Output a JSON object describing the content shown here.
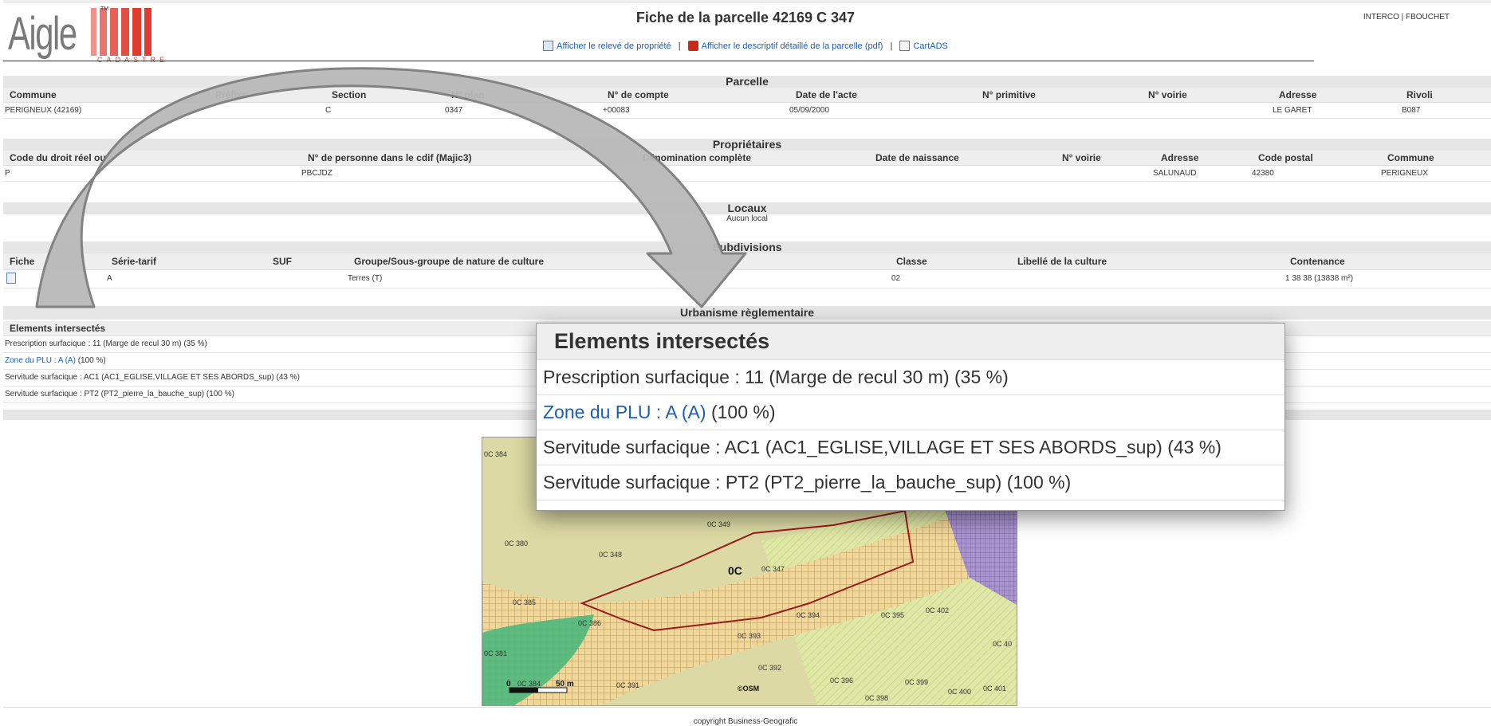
{
  "header": {
    "logo_word": "Aigle",
    "logo_sub": "CADASTRE",
    "logo_tm": "TM",
    "title": "Fiche de la parcelle 42169 C 347",
    "user": "INTERCO | FBOUCHET",
    "links": {
      "releve": "Afficher le relevé de propriété",
      "descriptif": "Afficher le descriptif détaillé de la parcelle (pdf)",
      "cartads": "CartADS",
      "sep": "|"
    }
  },
  "parcelle": {
    "title": "Parcelle",
    "headers": [
      "Commune",
      "Préfixe",
      "Section",
      "N° plan",
      "N° de compte",
      "Date de l'acte",
      "N° primitive",
      "N° voirie",
      "Adresse",
      "Rivoli"
    ],
    "row": [
      "PERIGNEUX (42169)",
      "",
      "C",
      "0347",
      "+00083",
      "05/09/2000",
      "",
      "",
      "LE GARET",
      "B087"
    ]
  },
  "proprietaires": {
    "title": "Propriétaires",
    "headers": [
      "Code du droit réel ou",
      "N° de personne dans le cdif (Majic3)",
      "Dénomination complète",
      "Date de naissance",
      "N° voirie",
      "Adresse",
      "Code postal",
      "Commune"
    ],
    "row": [
      "P",
      "PBCJDZ",
      "",
      "",
      "",
      "SALUNAUD",
      "42380",
      "PERIGNEUX"
    ]
  },
  "locaux": {
    "title": "Locaux",
    "empty": "Aucun local"
  },
  "subdivisions": {
    "title": "Subdivisions",
    "headers": [
      "Fiche",
      "Série-tarif",
      "SUF",
      "Groupe/Sous-groupe de nature de culture",
      "Classe",
      "Libellé de la culture",
      "Contenance"
    ],
    "row": [
      "",
      "A",
      "",
      "Terres (T)",
      "02",
      "",
      "1 38 38 (13838 m²)"
    ]
  },
  "urbanisme": {
    "title": "Urbanisme règlementaire",
    "header": "Elements intersectés",
    "items": [
      {
        "link": "",
        "text": "Prescription surfacique : 11 (Marge de recul 30 m) (35 %)"
      },
      {
        "link": "Zone du PLU : A (A)",
        "text": " (100 %)"
      },
      {
        "link": "",
        "text": "Servitude surfacique : AC1 (AC1_EGLISE,VILLAGE ET SES ABORDS_sup) (43 %)"
      },
      {
        "link": "",
        "text": "Servitude surfacique : PT2 (PT2_pierre_la_bauche_sup) (100 %)"
      }
    ]
  },
  "map": {
    "labels": [
      "0C 384",
      "0C 349",
      "0C 380",
      "0C 348",
      "0C 347",
      "0C 385",
      "0C 386",
      "0C 394",
      "0C 395",
      "0C 402",
      "0C 381",
      "0C 393",
      "0C 392",
      "0C 384",
      "0C 391",
      "0C 396",
      "0C 399",
      "0C 398",
      "0C 400",
      "0C 401",
      "0C 40"
    ],
    "section_label": "0C",
    "scale_zero": "0",
    "scale_end": "50 m",
    "osm": "©OSM",
    "colors": {
      "base": "#dcd9a4",
      "hatch_orange": "#e8962e",
      "green": "#4cb87c",
      "purple": "#7c64b4",
      "parcel": "#9c1a1a"
    }
  },
  "footer": "copyright Business-Geografic"
}
